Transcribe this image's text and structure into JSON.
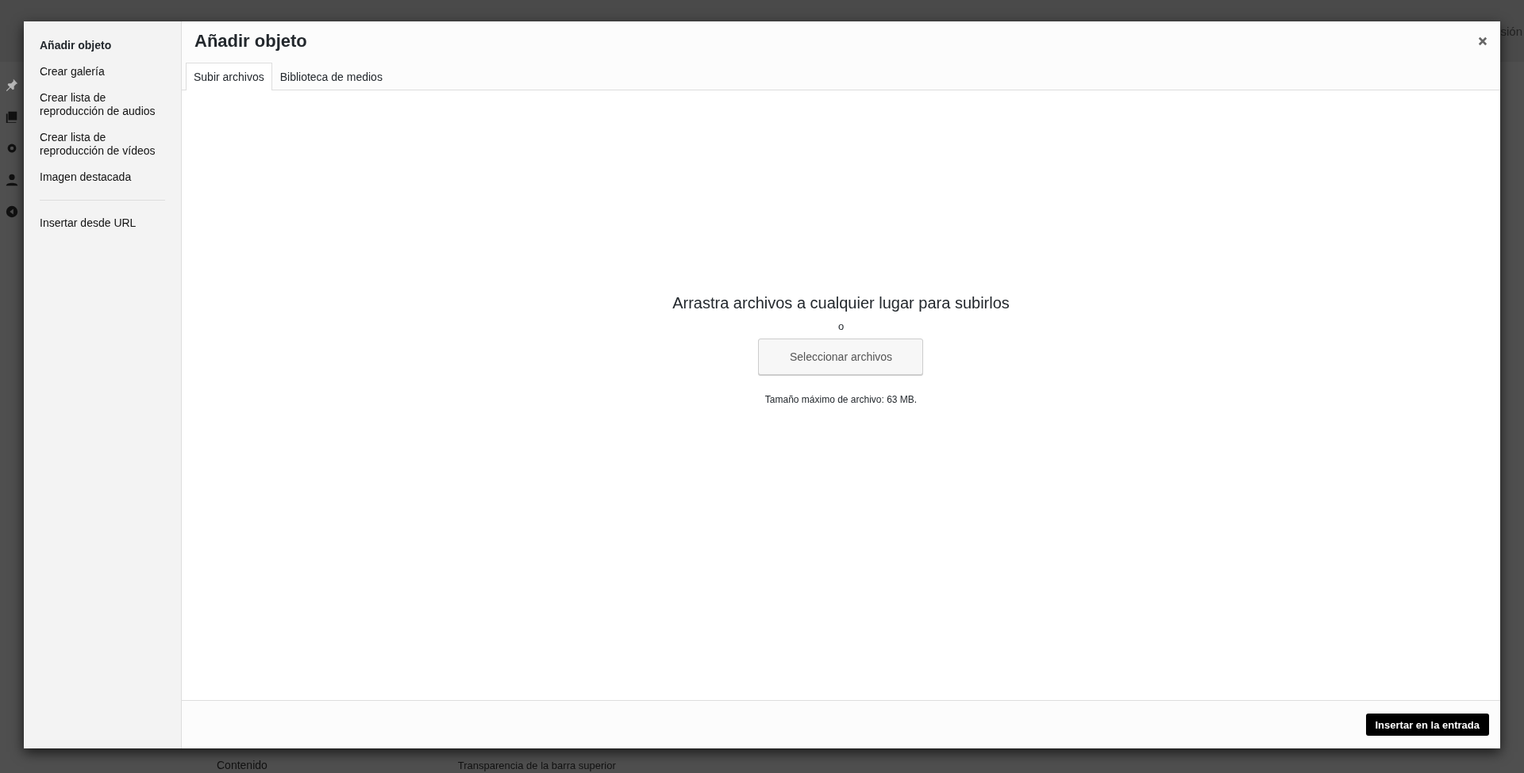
{
  "background": {
    "account_link": "sión",
    "section_label": "Contenido",
    "setting_label": "Transparencia de la barra superior"
  },
  "modal": {
    "menu_groups": [
      [
        {
          "label": "Añadir objeto",
          "selected": true
        },
        {
          "label": "Crear galería",
          "selected": false
        },
        {
          "label": "Crear lista de reproducción de audios",
          "selected": false
        },
        {
          "label": "Crear lista de reproducción de vídeos",
          "selected": false
        },
        {
          "label": "Imagen destacada",
          "selected": false
        }
      ],
      [
        {
          "label": "Insertar desde URL",
          "selected": false
        }
      ]
    ],
    "title": "Añadir objeto",
    "tabs": [
      {
        "label": "Subir archivos",
        "selected": true
      },
      {
        "label": "Biblioteca de medios",
        "selected": false
      }
    ],
    "uploader": {
      "heading": "Arrastra archivos a cualquier lugar para subirlos",
      "or": "o",
      "button": "Seleccionar archivos",
      "max_size": "Tamaño máximo de archivo: 63 MB."
    },
    "footer_button": "Insertar en la entrada"
  }
}
